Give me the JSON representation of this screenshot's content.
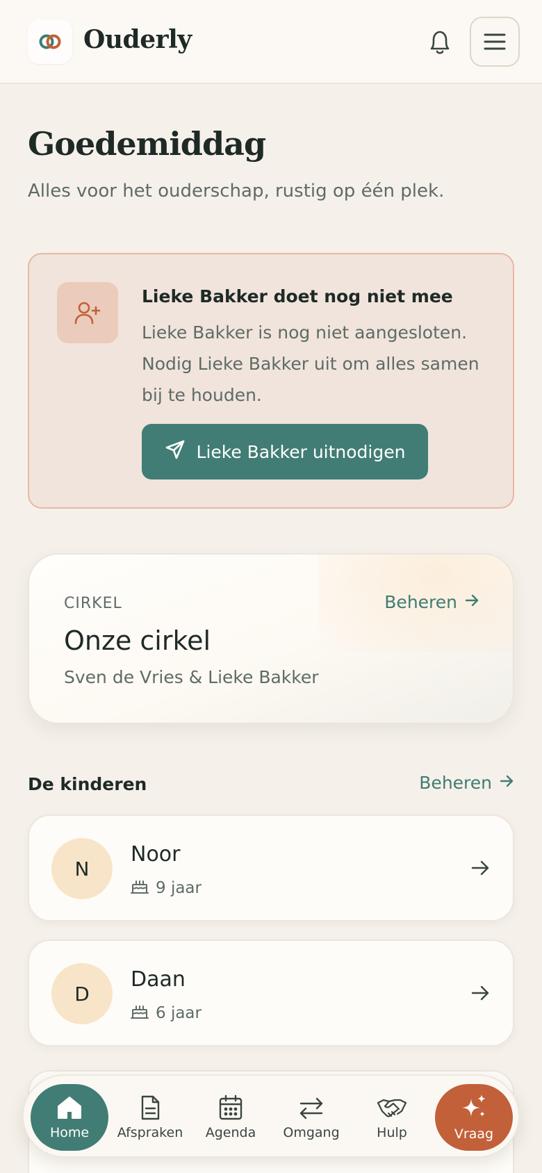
{
  "header": {
    "brand": "Ouderly",
    "logo_icon": "overlapping-rings-logo",
    "notifications_icon": "bell-icon",
    "menu_icon": "hamburger-menu-icon"
  },
  "greeting": {
    "title": "Goedemiddag",
    "subtitle": "Alles voor het ouderschap, rustig op één plek."
  },
  "invite": {
    "icon": "user-plus-icon",
    "title": "Lieke Bakker doet nog niet mee",
    "line1": "Lieke Bakker is nog niet aangesloten.",
    "line2": "Nodig Lieke Bakker uit om alles samen",
    "line3": "bij te houden.",
    "button_label": "Lieke Bakker uitnodigen",
    "button_icon": "send-icon"
  },
  "circle": {
    "eyebrow": "CIRKEL",
    "manage_label": "Beheren",
    "title": "Onze cirkel",
    "members": "Sven de Vries & Lieke Bakker"
  },
  "kids": {
    "heading": "De kinderen",
    "manage_label": "Beheren",
    "items": [
      {
        "initial": "N",
        "name": "Noor",
        "age": "9 jaar"
      },
      {
        "initial": "D",
        "name": "Daan",
        "age": "6 jaar"
      }
    ]
  },
  "nav": {
    "items": [
      {
        "label": "Home",
        "icon": "home-icon",
        "active": true
      },
      {
        "label": "Afspraken",
        "icon": "document-icon"
      },
      {
        "label": "Agenda",
        "icon": "calendar-icon"
      },
      {
        "label": "Omgang",
        "icon": "swap-arrows-icon"
      },
      {
        "label": "Hulp",
        "icon": "handshake-icon"
      },
      {
        "label": "Vraag",
        "icon": "sparkles-icon"
      }
    ]
  },
  "colors": {
    "primary": "#417d74",
    "accent": "#c2603a",
    "background": "#f5f1ea",
    "invite_bg": "#f0e4dc",
    "avatar_bg": "#f8e4c8"
  }
}
